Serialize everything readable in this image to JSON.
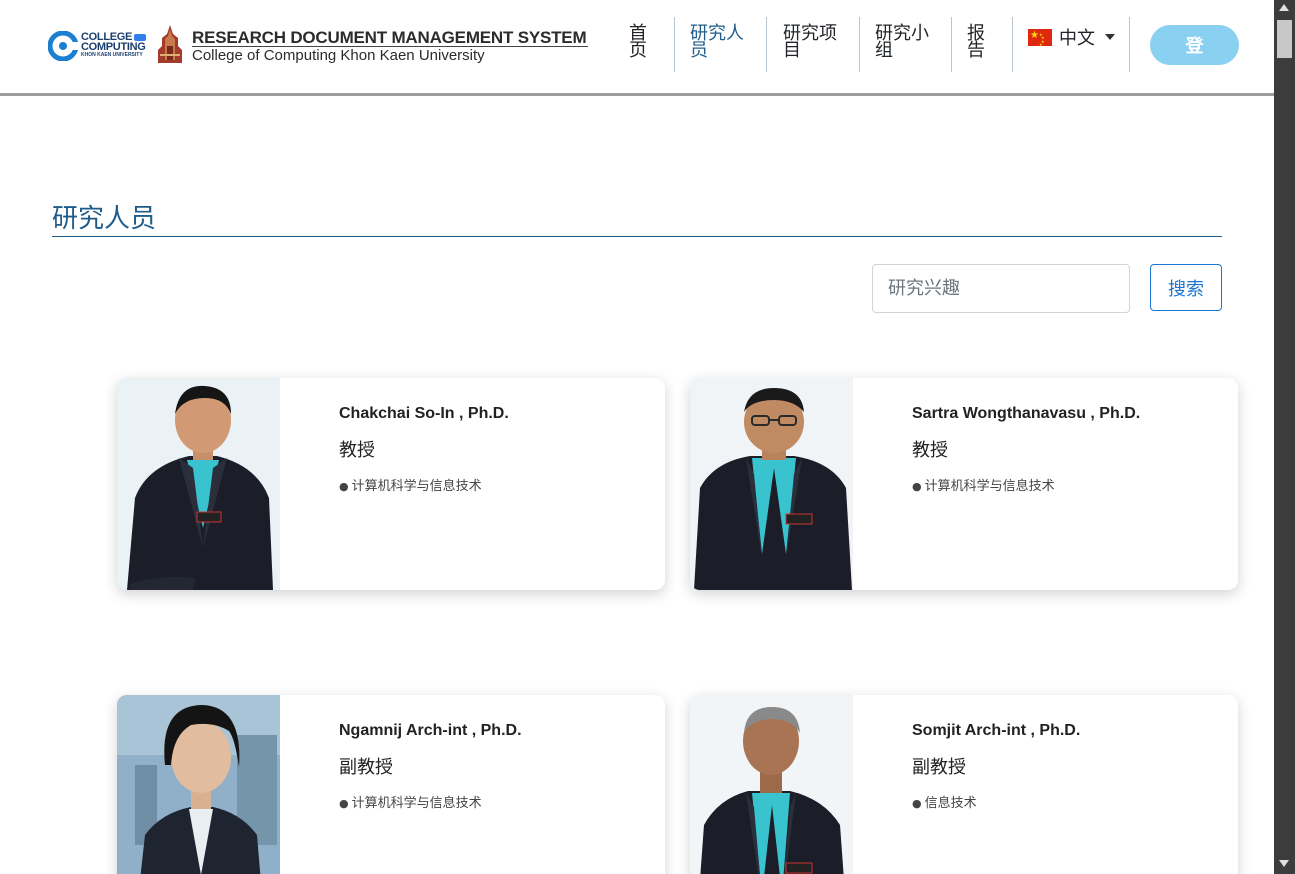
{
  "header": {
    "logo_line1": "COLLEGE",
    "logo_line2": "COMPUTING",
    "logo_line3": "KHON KAEN UNIVERSITY",
    "logo_of": "OF",
    "title": "RESEARCH DOCUMENT MANAGEMENT SYSTEM",
    "subtitle": "College of Computing Khon Kaen University"
  },
  "nav": {
    "items": [
      {
        "line1": "首",
        "line2": "页"
      },
      {
        "line1": "研究人",
        "line2": "员"
      },
      {
        "line1": "研究项",
        "line2": "目"
      },
      {
        "line1": "研究小",
        "line2": "组"
      },
      {
        "line1": "报",
        "line2": "告"
      }
    ],
    "active_index": 1,
    "language": "中文",
    "login_label": "登"
  },
  "main": {
    "title": "研究人员",
    "search_placeholder": "研究兴趣",
    "search_button": "搜索"
  },
  "researchers": [
    {
      "name": "Chakchai So-In , Ph.D.",
      "rank": "教授",
      "field": "计算机科学与信息技术"
    },
    {
      "name": "Sartra Wongthanavasu , Ph.D.",
      "rank": "教授",
      "field": "计算机科学与信息技术"
    },
    {
      "name": "Ngamnij Arch-int , Ph.D.",
      "rank": "副教授",
      "field": "计算机科学与信息技术"
    },
    {
      "name": "Somjit Arch-int , Ph.D.",
      "rank": "副教授",
      "field": "信息技术"
    }
  ],
  "colors": {
    "accent": "#1f5c8a",
    "login_button": "#8ad0f0",
    "search_button_border": "#1976d2",
    "flag_red": "#de2910"
  },
  "icons": [
    "college-of-computing-logo",
    "kku-seal-logo",
    "china-flag-icon",
    "caret-down-icon",
    "bullet-icon",
    "scroll-up-icon",
    "scroll-down-icon"
  ]
}
